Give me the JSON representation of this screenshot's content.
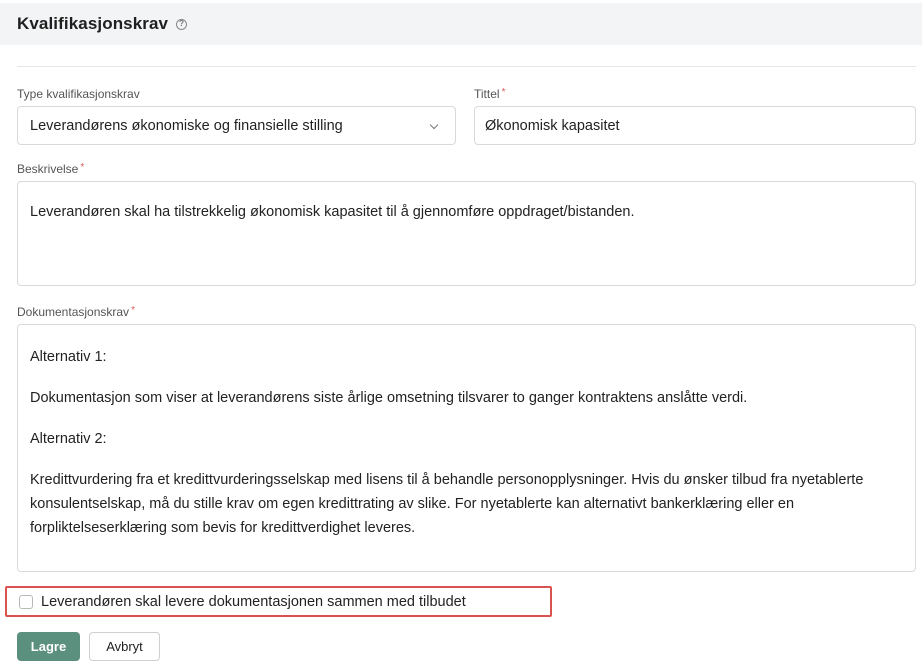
{
  "header": {
    "title": "Kvalifikasjonskrav",
    "help_icon": "question-circle-icon",
    "help_glyph": "?"
  },
  "form": {
    "type_label": "Type kvalifikasjonskrav",
    "type_value": "Leverandørens økonomiske og finansielle stilling",
    "title_label": "Tittel",
    "title_value": "Økonomisk kapasitet",
    "required_marker": "*",
    "description_label": "Beskrivelse",
    "description_value": "Leverandøren skal ha tilstrekkelig økonomisk kapasitet til å gjennomføre oppdraget/bistanden.",
    "documentation_label": "Dokumentasjonskrav",
    "documentation_paragraphs": [
      "Alternativ 1:",
      "Dokumentasjon som viser at leverandørens siste årlige omsetning tilsvarer to ganger kontraktens anslåtte verdi.",
      "Alternativ 2:",
      "Kredittvurdering fra et kredittvurderingsselskap med lisens til å behandle personopplysninger. Hvis du ønsker tilbud fra nyetablerte konsulentselskap, må du stille krav om egen kredittrating av slike. For nyetablerte kan alternativt bankerklæring eller en forpliktelseserklæring som bevis for kredittverdighet leveres."
    ],
    "checkbox_label": "Leverandøren skal levere dokumentasjonen sammen med tilbudet",
    "checkbox_checked": false
  },
  "actions": {
    "save_label": "Lagre",
    "cancel_label": "Avbryt"
  },
  "colors": {
    "primary_button": "#5b8f7e",
    "highlight_border": "#d9534f",
    "required": "#e05b5b"
  }
}
